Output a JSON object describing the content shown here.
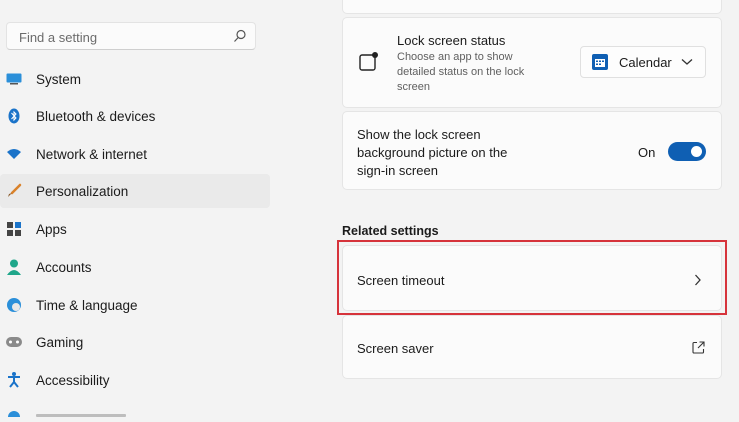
{
  "search": {
    "placeholder": "Find a setting"
  },
  "sidebar": {
    "items": [
      {
        "label": "System"
      },
      {
        "label": "Bluetooth & devices"
      },
      {
        "label": "Network & internet"
      },
      {
        "label": "Personalization"
      },
      {
        "label": "Apps"
      },
      {
        "label": "Accounts"
      },
      {
        "label": "Time & language"
      },
      {
        "label": "Gaming"
      },
      {
        "label": "Accessibility"
      }
    ]
  },
  "lock_screen_status": {
    "title": "Lock screen status",
    "description_lines": [
      "Choose an app to show",
      "detailed status on the lock",
      "screen"
    ],
    "dropdown_value": "Calendar"
  },
  "background_sign_in": {
    "label_lines": [
      "Show the lock screen",
      "background picture on the",
      "sign-in screen"
    ],
    "toggle_state": "On"
  },
  "related_settings": {
    "heading": "Related settings",
    "items": [
      {
        "label": "Screen timeout"
      },
      {
        "label": "Screen saver"
      }
    ]
  },
  "colors": {
    "accent": "#0f5fb3",
    "highlight_border": "#d6333b"
  }
}
